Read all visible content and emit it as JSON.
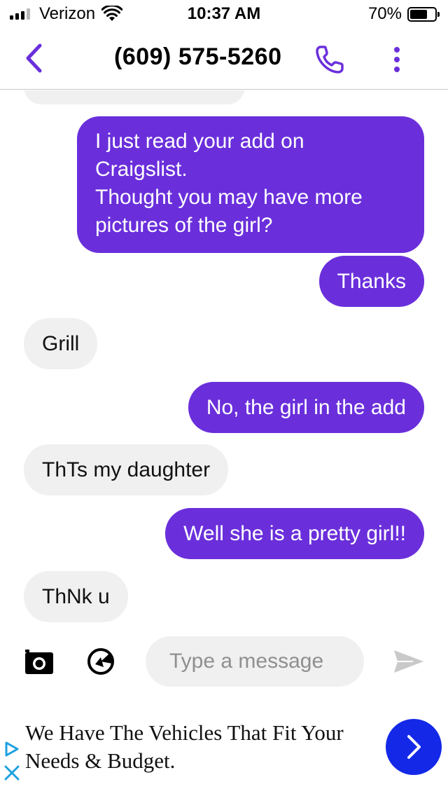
{
  "status_bar": {
    "carrier": "Verizon",
    "time": "10:37 AM",
    "battery_percent": "70%",
    "battery_level": 0.7,
    "signal_bars_active": 3,
    "signal_bars_total": 4
  },
  "header": {
    "contact": "(609) 575-5260",
    "back_icon": "chevron-left-icon",
    "call_icon": "phone-icon",
    "more_icon": "vertical-ellipsis-icon"
  },
  "messages": [
    {
      "direction": "incoming",
      "text": "",
      "partial": true
    },
    {
      "direction": "outgoing",
      "lines": [
        "I just read your add on",
        "Craigslist.",
        "Thought you may have more",
        "pictures of the girl?"
      ]
    },
    {
      "direction": "outgoing",
      "text": "Thanks"
    },
    {
      "direction": "incoming",
      "text": "Grill"
    },
    {
      "direction": "outgoing",
      "text": "No, the girl in the add"
    },
    {
      "direction": "incoming",
      "text": "ThTs my daughter"
    },
    {
      "direction": "outgoing",
      "text": "Well she is a pretty girl!!"
    },
    {
      "direction": "incoming",
      "text": "ThNk u"
    }
  ],
  "composer": {
    "placeholder": "Type a message",
    "value": "",
    "camera_icon": "camera-icon",
    "gif_icon": "gif-sticker-icon",
    "send_icon": "send-icon"
  },
  "ad": {
    "line1": "We Have The Vehicles That Fit Your",
    "line2": "Needs & Budget.",
    "choices_icon": "ad-choices-icon",
    "close_icon": "close-icon",
    "cta_icon": "chevron-right-icon"
  },
  "colors": {
    "accent": "#6a2fdb",
    "outgoing_bubble": "#6a2fdb",
    "incoming_bubble": "#f0f0f0",
    "ad_button": "#1428e8",
    "ad_choices": "#1ca0e0"
  }
}
